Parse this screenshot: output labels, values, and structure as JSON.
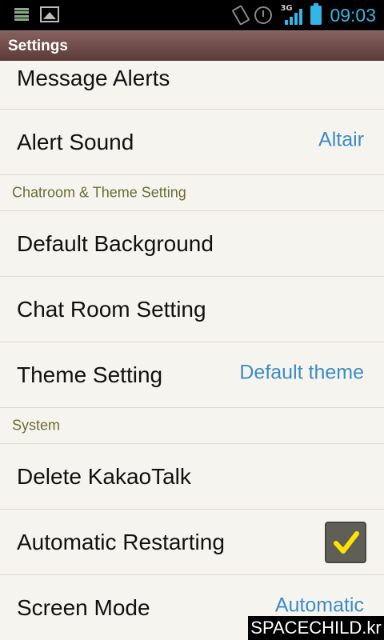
{
  "status_bar": {
    "time": "09:03",
    "network_type": "3G",
    "left_icons": [
      "list-icon",
      "image-icon"
    ],
    "right_icons": [
      "vibrate-icon",
      "alarm-icon",
      "signal-icon",
      "battery-icon"
    ]
  },
  "title_bar": {
    "title": "Settings"
  },
  "rows": {
    "message_alerts": {
      "label": "Message Alerts"
    },
    "alert_sound": {
      "label": "Alert Sound",
      "value": "Altair"
    },
    "section_chatroom": {
      "label": "Chatroom & Theme Setting"
    },
    "default_background": {
      "label": "Default Background"
    },
    "chat_room_setting": {
      "label": "Chat Room Setting"
    },
    "theme_setting": {
      "label": "Theme Setting",
      "value": "Default theme"
    },
    "section_system": {
      "label": "System"
    },
    "delete_kakaotalk": {
      "label": "Delete KakaoTalk"
    },
    "automatic_restarting": {
      "label": "Automatic Restarting",
      "checked": true
    },
    "screen_mode": {
      "label": "Screen Mode",
      "value": "Automatic"
    }
  },
  "watermark": {
    "text": "SPACECHILD.kr"
  },
  "colors": {
    "title_bar": "#6e4c49",
    "value_text": "#3d8cc4",
    "section_text": "#6d6b32",
    "checkmark": "#ffe400",
    "clock": "#33b5e5"
  }
}
